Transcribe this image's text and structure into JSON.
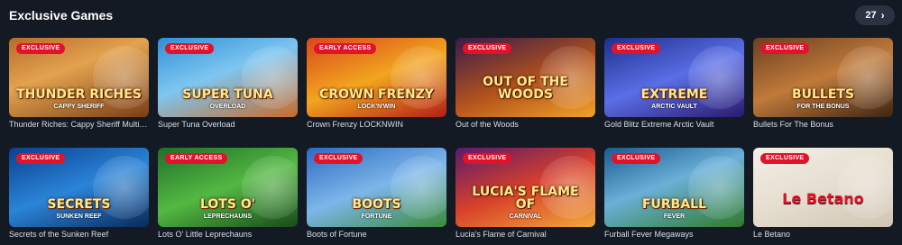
{
  "section": {
    "title": "Exclusive Games",
    "count": "27"
  },
  "games_row1": [
    {
      "name": "Thunder Riches: Cappy Sheriff MultiChase",
      "badge": "EXCLUSIVE",
      "art_title": "THUNDER RICHES",
      "art_sub": "CAPPY SHERIFF",
      "bg": "linear-gradient(160deg,#b56a2a 0%,#e3a24f 40%,#7a3e16 100%)"
    },
    {
      "name": "Super Tuna Overload",
      "badge": "EXCLUSIVE",
      "art_title": "SUPER TUNA",
      "art_sub": "OVERLOAD",
      "bg": "linear-gradient(160deg,#2f8fd6 0%,#7ec6f0 45%,#c86a2a 100%)"
    },
    {
      "name": "Crown Frenzy LOCKNWIN",
      "badge": "EARLY ACCESS",
      "art_title": "CROWN FRENZY",
      "art_sub": "LOCK'N'WIN",
      "bg": "linear-gradient(160deg,#d9461c 0%,#f2a51f 50%,#b31e16 100%)"
    },
    {
      "name": "Out of the Woods",
      "badge": "EXCLUSIVE",
      "art_title": "OUT OF THE WOODS",
      "art_sub": "",
      "bg": "linear-gradient(160deg,#3a1a4a 0%,#b5541c 55%,#f0a12a 100%)"
    },
    {
      "name": "Gold Blitz Extreme Arctic Vault",
      "badge": "EXCLUSIVE",
      "art_title": "EXTREME",
      "art_sub": "ARCTIC VAULT",
      "bg": "linear-gradient(160deg,#1d2f8c 0%,#5a6ee6 50%,#2a1a6e 100%)"
    },
    {
      "name": "Bullets For The Bonus",
      "badge": "EXCLUSIVE",
      "art_title": "BULLETS",
      "art_sub": "FOR THE BONUS",
      "bg": "linear-gradient(160deg,#6b3f22 0%,#c07a3a 50%,#3e2414 100%)"
    }
  ],
  "games_row2": [
    {
      "name": "Secrets of the Sunken Reef",
      "badge": "EXCLUSIVE",
      "art_title": "SECRETS",
      "art_sub": "SUNKEN REEF",
      "bg": "linear-gradient(160deg,#0b3f8e 0%,#2a84d8 50%,#0a2a5a 100%)"
    },
    {
      "name": "Lots O' Little Leprechauns",
      "badge": "EARLY ACCESS",
      "art_title": "LOTS O'",
      "art_sub": "LEPRECHAUNS",
      "bg": "linear-gradient(160deg,#1f6e2a 0%,#53b842 50%,#184a1a 100%)"
    },
    {
      "name": "Boots of Fortune",
      "badge": "EXCLUSIVE",
      "art_title": "BOOTS",
      "art_sub": "FORTUNE",
      "bg": "linear-gradient(160deg,#2c6bc0 0%,#7cb6ea 50%,#3a8a3a 100%)"
    },
    {
      "name": "Lucia's Flame of Carnival",
      "badge": "EXCLUSIVE",
      "art_title": "LUCIA'S FLAME OF",
      "art_sub": "CARNIVAL",
      "bg": "linear-gradient(160deg,#5a1a6e 0%,#d8402a 50%,#f2a83a 100%)"
    },
    {
      "name": "Furball Fever Megaways",
      "badge": "EXCLUSIVE",
      "art_title": "FURBALL",
      "art_sub": "FEVER",
      "bg": "linear-gradient(160deg,#1a5a8e 0%,#6ab0d8 45%,#2f7a2a 100%)"
    },
    {
      "name": "Le Betano",
      "badge": "EXCLUSIVE",
      "art_title": "Le Betano",
      "art_sub": "",
      "bg": "linear-gradient(160deg,#f2efe6 0%,#e6ded0 50%,#cfc5b3 100%)"
    }
  ],
  "colors": {
    "page_bg": "#141a24",
    "badge_red": "#e3122b",
    "pill_bg": "#2a3342"
  },
  "icons": {
    "pill_chevron": "chevron-right-icon"
  }
}
